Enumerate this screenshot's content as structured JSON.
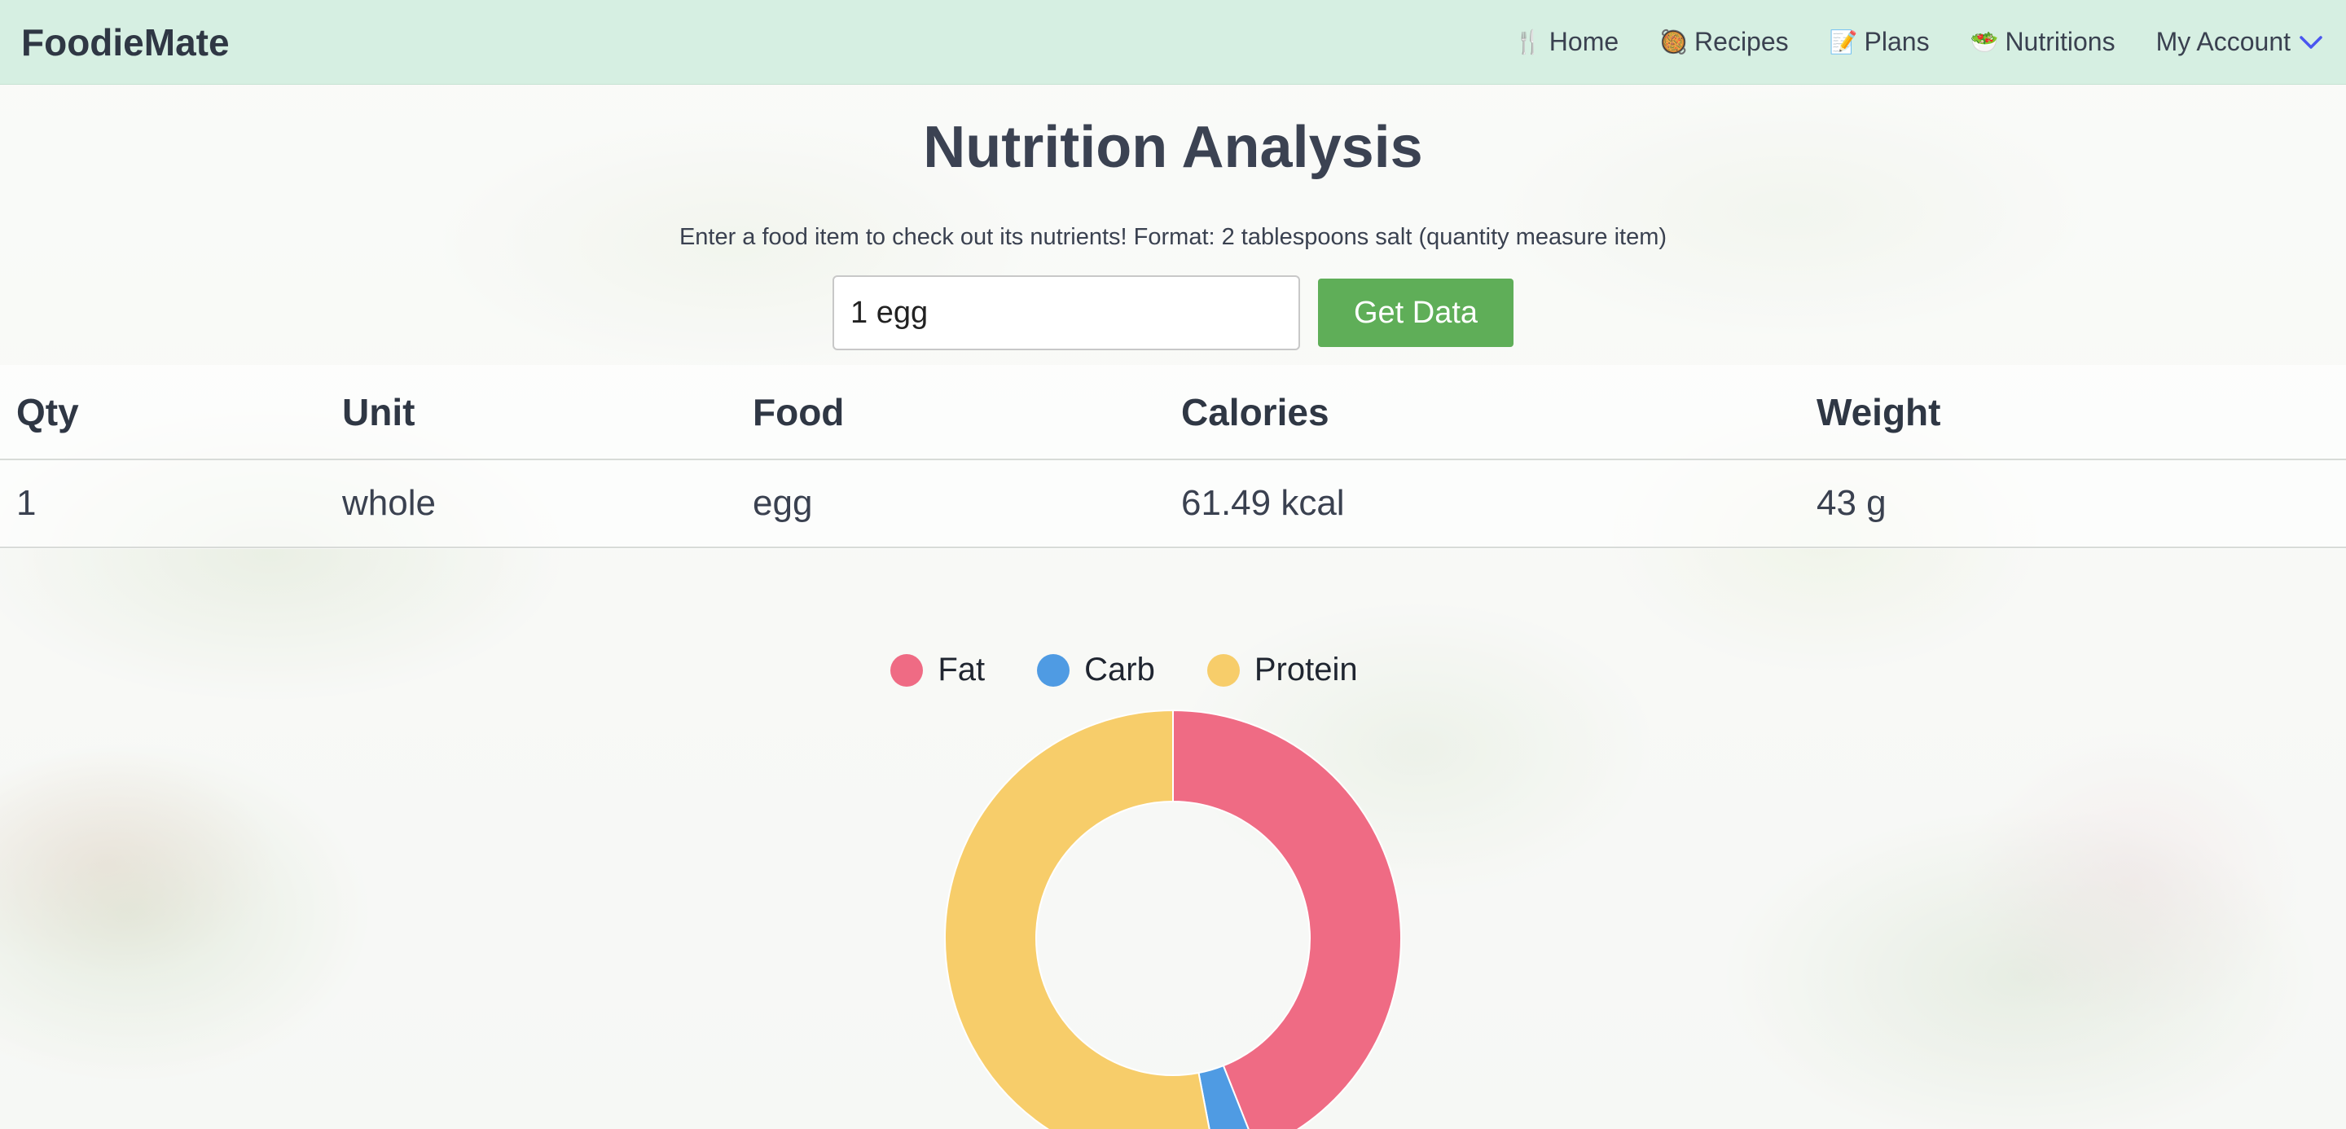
{
  "app": {
    "brand": "FoodieMate"
  },
  "nav": {
    "items": [
      {
        "emoji": "🍴",
        "label": "Home",
        "icon": "fork-knife-icon"
      },
      {
        "emoji": "🥘",
        "label": "Recipes",
        "icon": "dish-icon"
      },
      {
        "emoji": "📝",
        "label": "Plans",
        "icon": "memo-icon"
      },
      {
        "emoji": "🥗",
        "label": "Nutritions",
        "icon": "salad-icon"
      }
    ],
    "account": "My Account",
    "accent": "#4a56f0"
  },
  "page": {
    "title": "Nutrition Analysis",
    "instructions": "Enter a food item to check out its nutrients! Format: 2 tablespoons salt (quantity measure item)"
  },
  "search": {
    "value": "1 egg",
    "button_label": "Get Data",
    "button_color": "#5fae58"
  },
  "table": {
    "headers": [
      "Qty",
      "Unit",
      "Food",
      "Calories",
      "Weight"
    ],
    "rows": [
      [
        "1",
        "whole",
        "egg",
        "61.49 kcal",
        "43 g"
      ]
    ]
  },
  "chart_data": {
    "type": "pie",
    "donut": true,
    "categories": [
      "Fat",
      "Carb",
      "Protein"
    ],
    "values": [
      44,
      3,
      53
    ],
    "colors": [
      "#ef6b84",
      "#4f9be3",
      "#f7cd6a"
    ],
    "legend_position": "top"
  }
}
